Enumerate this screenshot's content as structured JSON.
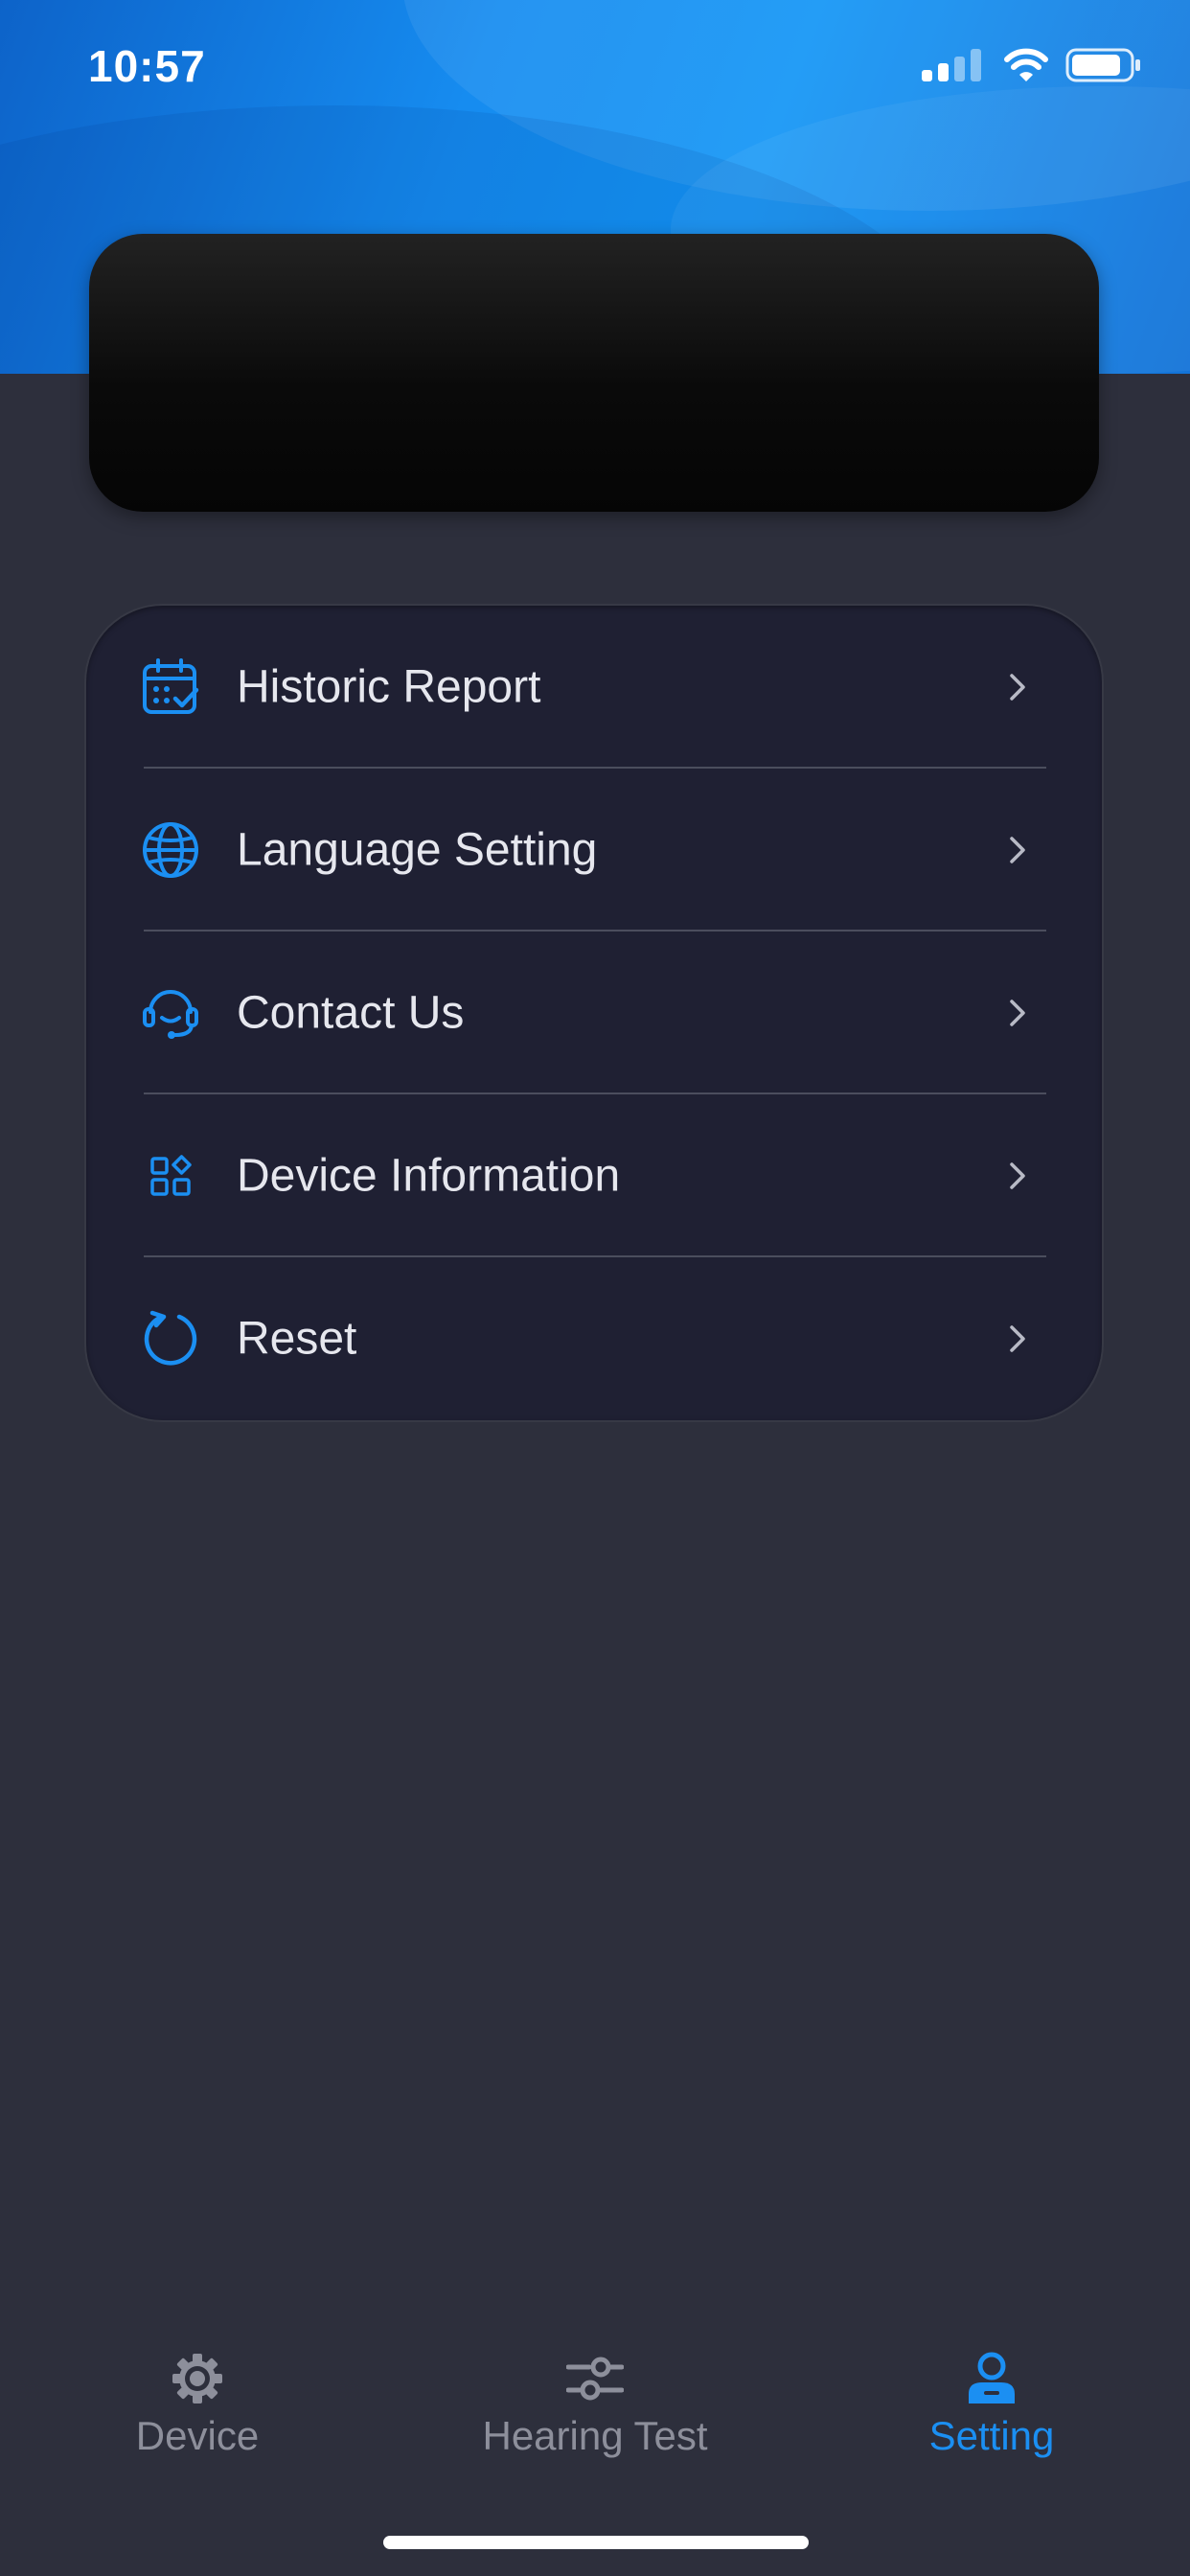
{
  "status_bar": {
    "time": "10:57"
  },
  "menu": {
    "items": [
      {
        "label": "Historic Report",
        "icon": "calendar-check-icon"
      },
      {
        "label": "Language Setting",
        "icon": "globe-icon"
      },
      {
        "label": "Contact Us",
        "icon": "headset-icon"
      },
      {
        "label": "Device Information",
        "icon": "apps-grid-icon"
      },
      {
        "label": "Reset",
        "icon": "reset-icon"
      }
    ]
  },
  "tabbar": {
    "tabs": [
      {
        "label": "Device",
        "icon": "gear-icon",
        "active": false
      },
      {
        "label": "Hearing Test",
        "icon": "sliders-icon",
        "active": false
      },
      {
        "label": "Setting",
        "icon": "user-icon",
        "active": true
      }
    ]
  },
  "colors": {
    "accent": "#1b8ff2",
    "background": "#2d2f3c",
    "card": "#1f2033",
    "header": "#168cf0",
    "inactive_tab": "#8d8f9b"
  }
}
